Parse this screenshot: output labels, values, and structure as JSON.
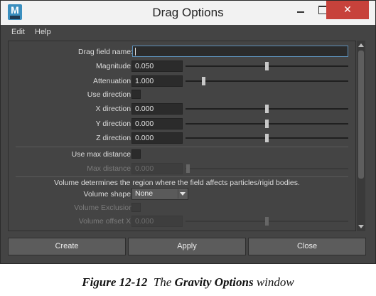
{
  "window": {
    "title": "Drag Options",
    "logo_letter": "M"
  },
  "menu": [
    "Edit",
    "Help"
  ],
  "fields": {
    "drag_field_name": {
      "label": "Drag field name:",
      "value": ""
    },
    "magnitude": {
      "label": "Magnitude:",
      "value": "0.050",
      "slider": 0.5
    },
    "attenuation": {
      "label": "Attenuation:",
      "value": "1.000",
      "slider": 0.1
    },
    "use_direction": {
      "label": "Use direction:",
      "checked": false
    },
    "x_direction": {
      "label": "X direction:",
      "value": "0.000",
      "slider": 0.5
    },
    "y_direction": {
      "label": "Y direction:",
      "value": "0.000",
      "slider": 0.5
    },
    "z_direction": {
      "label": "Z direction:",
      "value": "0.000",
      "slider": 0.5
    },
    "use_max_distance": {
      "label": "Use max distance:",
      "checked": false
    },
    "max_distance": {
      "label": "Max distance:",
      "value": "0.000",
      "slider": 0.02,
      "enabled": false
    },
    "volume_info": "Volume determines the region where the field affects particles/rigid bodies.",
    "volume_shape": {
      "label": "Volume shape:",
      "value": "None"
    },
    "volume_exclusion": {
      "label": "Volume Exclusion",
      "checked": false,
      "enabled": false
    },
    "volume_offset_x": {
      "label": "Volume offset X:",
      "value": "0.000",
      "slider": 0.5,
      "enabled": false
    }
  },
  "buttons": {
    "create": "Create",
    "apply": "Apply",
    "close": "Close"
  },
  "caption": {
    "prefix": "Figure 12-12",
    "the": "The",
    "name": "Gravity Options",
    "suffix": "window"
  }
}
